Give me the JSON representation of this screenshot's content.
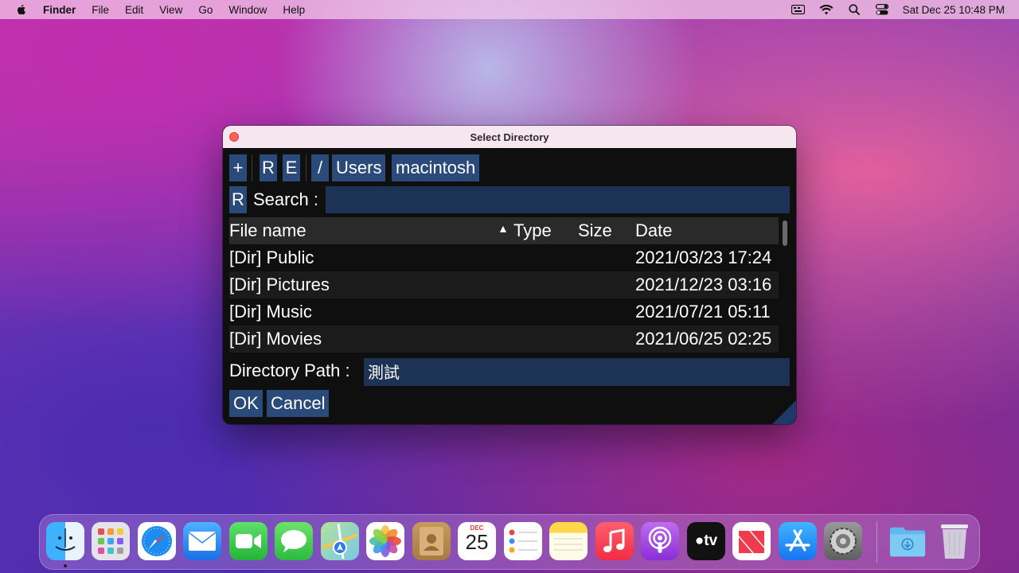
{
  "menubar": {
    "app_name": "Finder",
    "items": [
      "File",
      "Edit",
      "View",
      "Go",
      "Window",
      "Help"
    ],
    "clock": "Sat Dec 25  10:48 PM"
  },
  "dialog": {
    "title": "Select Directory",
    "path_buttons": [
      "+",
      "R",
      "E",
      "/",
      "Users",
      "macintosh"
    ],
    "search_reset": "R",
    "search_label": "Search :",
    "search_value": "",
    "columns": {
      "name": "File name",
      "type": "Type",
      "size": "Size",
      "date": "Date"
    },
    "sort_indicator": "▲",
    "rows": [
      {
        "name": "[Dir] Public",
        "type": "",
        "size": "",
        "date": "2021/03/23 17:24"
      },
      {
        "name": "[Dir] Pictures",
        "type": "",
        "size": "",
        "date": "2021/12/23 03:16"
      },
      {
        "name": "[Dir] Music",
        "type": "",
        "size": "",
        "date": "2021/07/21 05:11"
      },
      {
        "name": "[Dir] Movies",
        "type": "",
        "size": "",
        "date": "2021/06/25 02:25"
      }
    ],
    "path_label": "Directory Path :",
    "path_value": "測試",
    "ok_label": "OK",
    "cancel_label": "Cancel"
  },
  "dock": {
    "calendar_month": "DEC",
    "calendar_day": "25",
    "tv_label": "tv"
  },
  "colors": {
    "button_bg": "#2a4a7a",
    "input_bg": "#1c3355",
    "window_bg": "#0f0f0f"
  }
}
